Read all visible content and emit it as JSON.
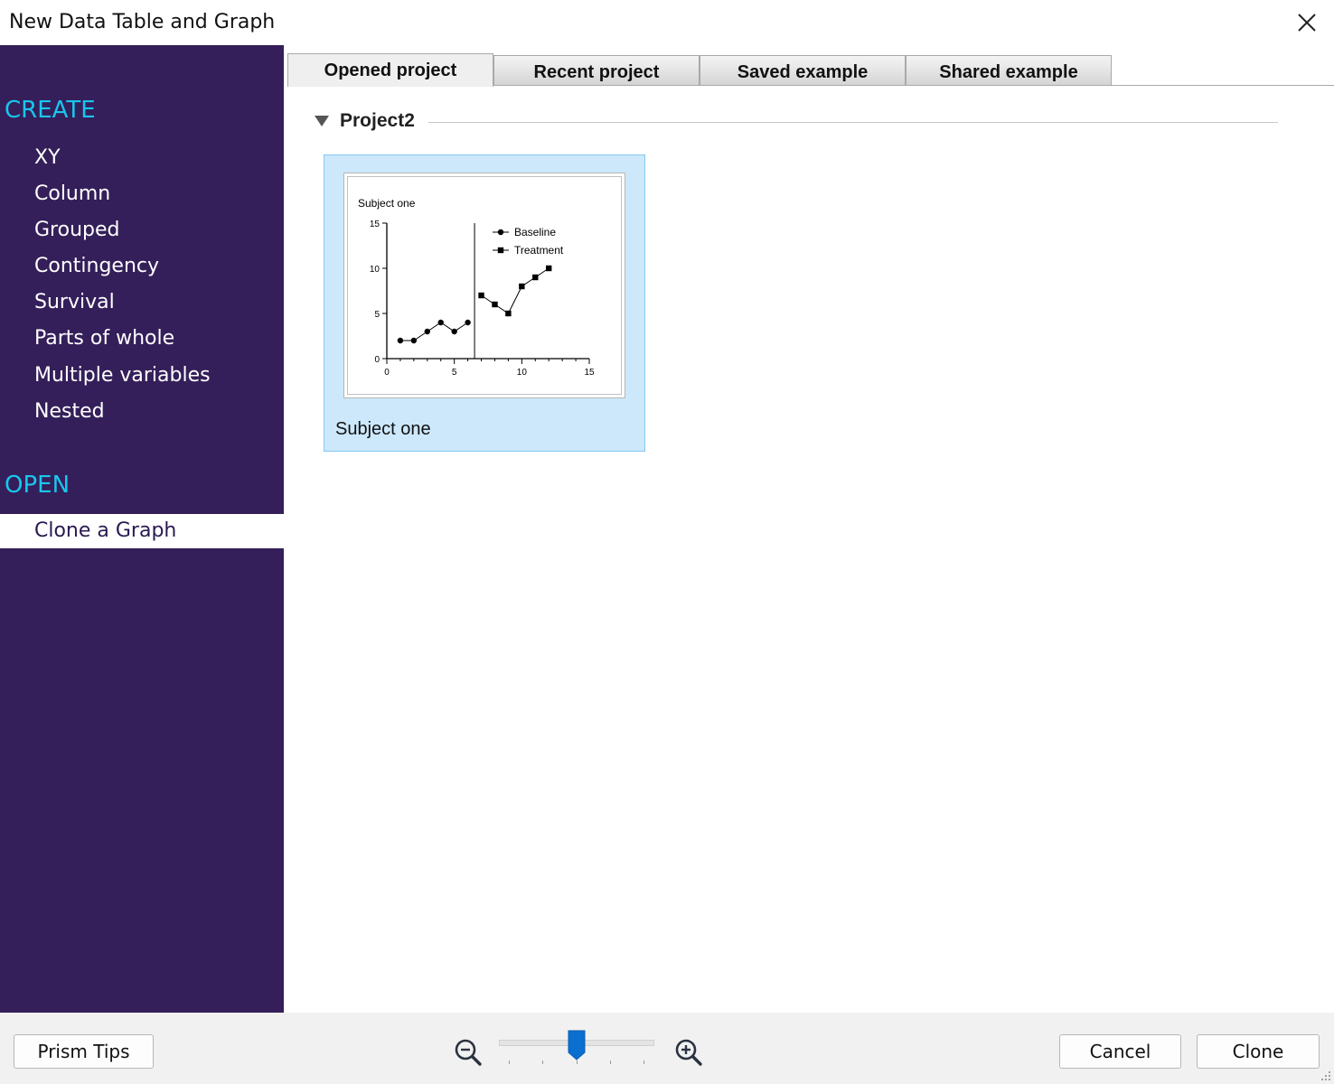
{
  "window": {
    "title": "New Data Table and Graph"
  },
  "sidebar": {
    "create_heading": "CREATE",
    "create_items": [
      {
        "label": "XY"
      },
      {
        "label": "Column"
      },
      {
        "label": "Grouped"
      },
      {
        "label": "Contingency"
      },
      {
        "label": "Survival"
      },
      {
        "label": "Parts of whole"
      },
      {
        "label": "Multiple variables"
      },
      {
        "label": "Nested"
      }
    ],
    "open_heading": "OPEN",
    "open_items": [
      {
        "label": "Clone a Graph",
        "selected": true
      }
    ]
  },
  "tabs": [
    {
      "label": "Opened project",
      "active": true
    },
    {
      "label": "Recent project",
      "active": false
    },
    {
      "label": "Saved example",
      "active": false
    },
    {
      "label": "Shared example",
      "active": false
    }
  ],
  "project": {
    "name": "Project2",
    "graphs": [
      {
        "label": "Subject one"
      }
    ]
  },
  "chart_data": {
    "type": "line",
    "title": "Subject one",
    "xlabel": "",
    "ylabel": "",
    "xlim": [
      0,
      15
    ],
    "ylim": [
      0,
      15
    ],
    "x_ticks": [
      0,
      5,
      10,
      15
    ],
    "y_ticks": [
      0,
      5,
      10,
      15
    ],
    "divider_x": 6.5,
    "legend_position": "top-right",
    "series": [
      {
        "name": "Baseline",
        "marker": "circle",
        "x": [
          1,
          2,
          3,
          4,
          5,
          6
        ],
        "y": [
          2,
          2,
          3,
          4,
          3,
          4
        ]
      },
      {
        "name": "Treatment",
        "marker": "square",
        "x": [
          7,
          8,
          9,
          10,
          11,
          12
        ],
        "y": [
          7,
          6,
          5,
          8,
          9,
          10
        ]
      }
    ]
  },
  "zoom": {
    "level_fraction": 0.5
  },
  "footer": {
    "tips_label": "Prism Tips",
    "cancel_label": "Cancel",
    "clone_label": "Clone"
  },
  "colors": {
    "sidebar_bg": "#341f5a",
    "section_heading": "#19c6ec",
    "card_bg": "#cde8fb",
    "slider_thumb": "#0b6fd0"
  }
}
